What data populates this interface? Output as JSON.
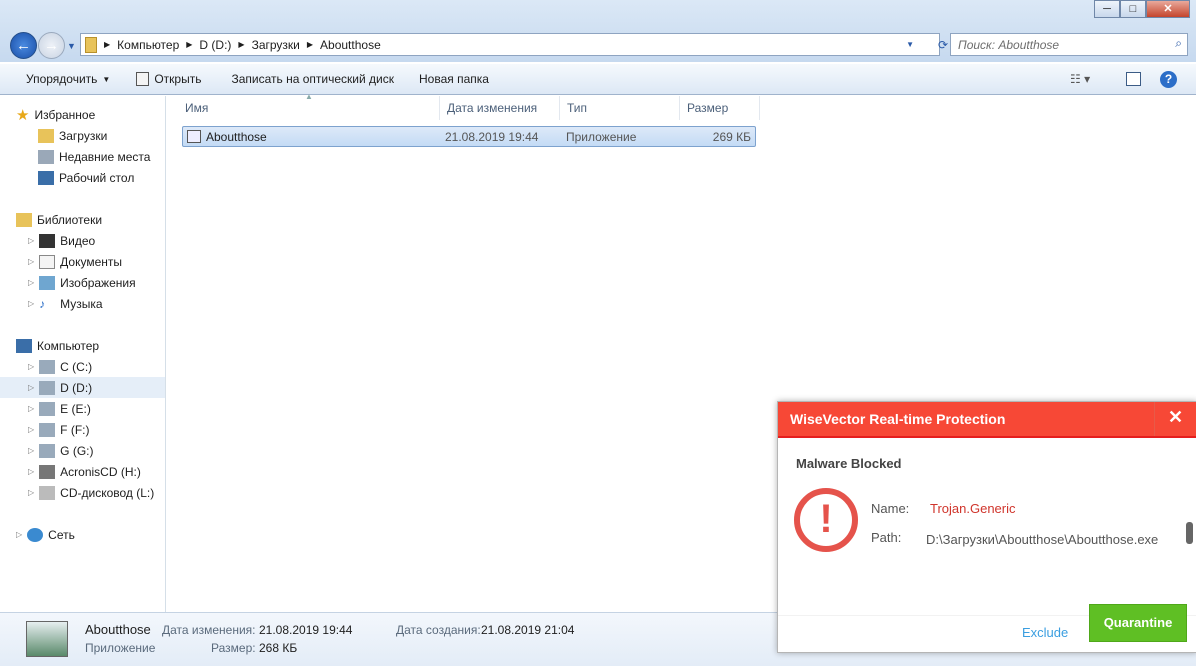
{
  "window": {
    "minimize": "─",
    "maximize": "□",
    "close": "✕"
  },
  "address": {
    "path": [
      "Компьютер",
      "D (D:)",
      "Загрузки",
      "Aboutthose"
    ],
    "search_placeholder": "Поиск: Aboutthose"
  },
  "toolbar": {
    "organize": "Упорядочить",
    "open": "Открыть",
    "burn": "Записать на оптический диск",
    "new_folder": "Новая папка"
  },
  "sidebar": {
    "favorites": {
      "label": "Избранное",
      "items": [
        "Загрузки",
        "Недавние места",
        "Рабочий стол"
      ]
    },
    "libraries": {
      "label": "Библиотеки",
      "items": [
        "Видео",
        "Документы",
        "Изображения",
        "Музыка"
      ]
    },
    "computer": {
      "label": "Компьютер",
      "items": [
        "C (C:)",
        "D (D:)",
        "E (E:)",
        "F (F:)",
        "G (G:)",
        "AcronisCD (H:)",
        "CD-дисковод (L:)"
      ]
    },
    "network": {
      "label": "Сеть"
    }
  },
  "columns": [
    "Имя",
    "Дата изменения",
    "Тип",
    "Размер"
  ],
  "files": [
    {
      "name": "Aboutthose",
      "date": "21.08.2019 19:44",
      "type": "Приложение",
      "size": "269 КБ"
    }
  ],
  "details": {
    "name": "Aboutthose",
    "type": "Приложение",
    "modified_label": "Дата изменения:",
    "modified": "21.08.2019 19:44",
    "size_label": "Размер:",
    "size": "268 КБ",
    "created_label": "Дата создания:",
    "created": "21.08.2019 21:04"
  },
  "popup": {
    "title": "WiseVector Real-time Protection",
    "close": "✕",
    "heading": "Malware Blocked",
    "name_label": "Name:",
    "name": "Trojan.Generic",
    "path_label": "Path:",
    "path": "D:\\Загрузки\\Aboutthose\\Aboutthose.exe",
    "exclude": "Exclude",
    "quarantine": "Quarantine",
    "accent": "#f74836",
    "button_color": "#5fbf24"
  }
}
